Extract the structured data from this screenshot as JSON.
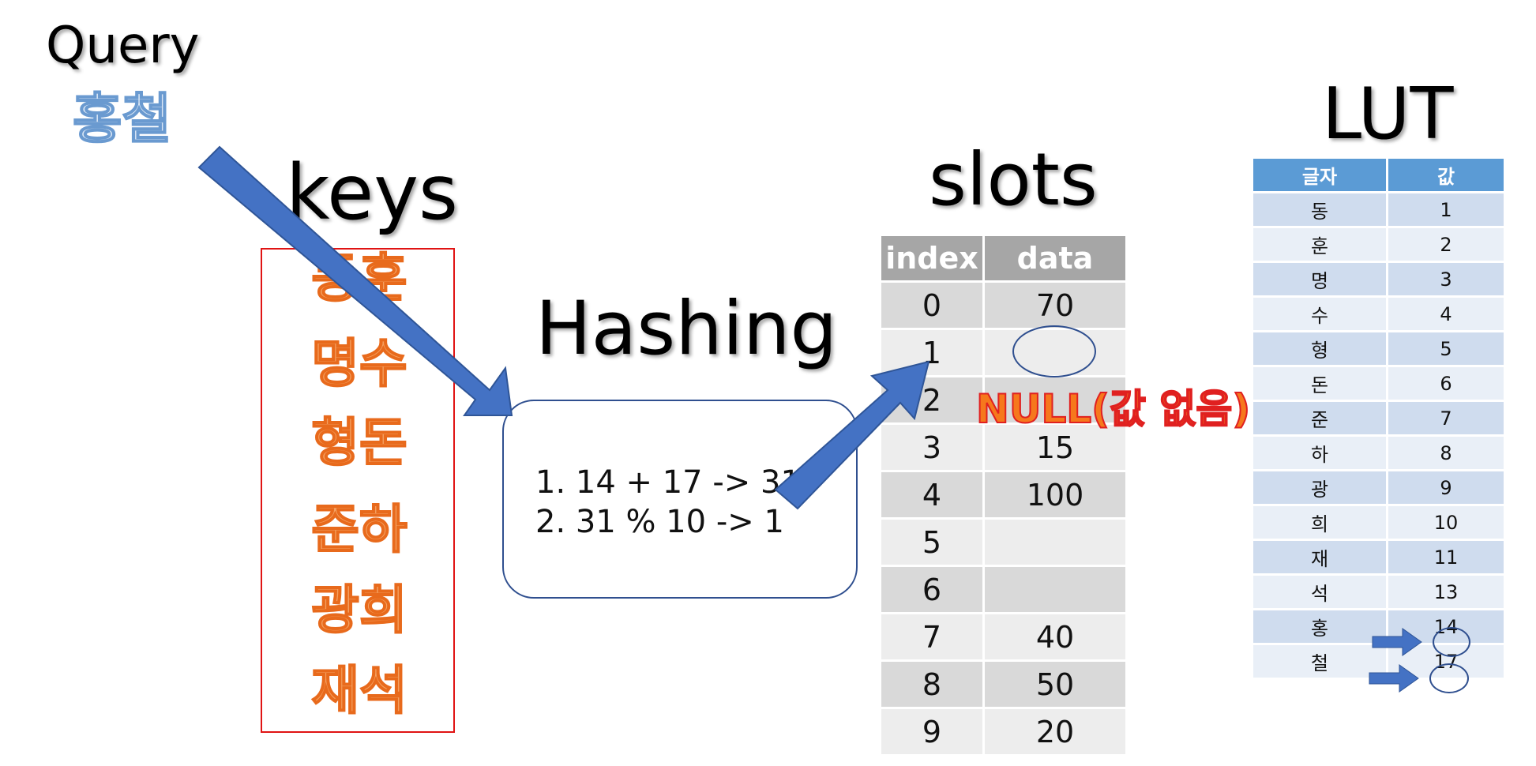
{
  "query": {
    "title": "Query",
    "name": "홍철"
  },
  "keys": {
    "title": "keys",
    "items": [
      "동훈",
      "명수",
      "형돈",
      "준하",
      "광희",
      "재석"
    ]
  },
  "hashing": {
    "title": "Hashing",
    "lines": [
      "1.  14 + 17 -> 31",
      "2.  31 % 10 -> 1"
    ]
  },
  "slots": {
    "title": "slots",
    "headers": [
      "index",
      "data"
    ],
    "rows": [
      {
        "index": "0",
        "data": "70"
      },
      {
        "index": "1",
        "data": ""
      },
      {
        "index": "2",
        "data": ""
      },
      {
        "index": "3",
        "data": "15"
      },
      {
        "index": "4",
        "data": "100"
      },
      {
        "index": "5",
        "data": ""
      },
      {
        "index": "6",
        "data": ""
      },
      {
        "index": "7",
        "data": "40"
      },
      {
        "index": "8",
        "data": "50"
      },
      {
        "index": "9",
        "data": "20"
      }
    ],
    "null_label": "NULL(값 없음)"
  },
  "lut": {
    "title": "LUT",
    "headers": [
      "글자",
      "값"
    ],
    "rows": [
      {
        "char": "동",
        "value": "1"
      },
      {
        "char": "훈",
        "value": "2"
      },
      {
        "char": "명",
        "value": "3"
      },
      {
        "char": "수",
        "value": "4"
      },
      {
        "char": "형",
        "value": "5"
      },
      {
        "char": "돈",
        "value": "6"
      },
      {
        "char": "준",
        "value": "7"
      },
      {
        "char": "하",
        "value": "8"
      },
      {
        "char": "광",
        "value": "9"
      },
      {
        "char": "희",
        "value": "10"
      },
      {
        "char": "재",
        "value": "11"
      },
      {
        "char": "석",
        "value": "13"
      },
      {
        "char": "홍",
        "value": "14"
      },
      {
        "char": "철",
        "value": "17"
      }
    ]
  },
  "colors": {
    "arrow": "#4472c4",
    "key_text": "#f4a060",
    "null_text": "#f6781c",
    "lut_header": "#5b9bd5",
    "slots_header": "#a6a6a6"
  }
}
